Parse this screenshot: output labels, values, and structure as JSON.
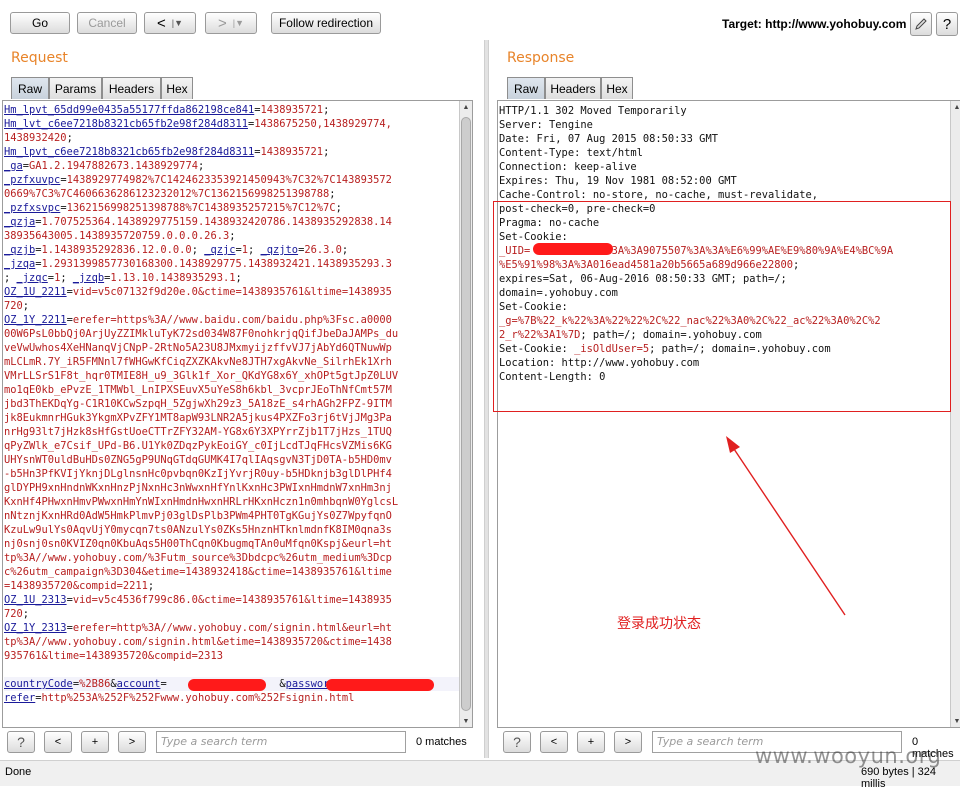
{
  "toolbar": {
    "go_label": "Go",
    "cancel_label": "Cancel",
    "back_symbol": "<",
    "back_dropdown": "|▼",
    "forward_symbol": ">",
    "forward_dropdown": "|▼",
    "follow_redirection_label": "Follow redirection",
    "target_label": "Target: http://www.yohobuy.com",
    "help_symbol": "?"
  },
  "request": {
    "title": "Request",
    "tabs": [
      "Raw",
      "Params",
      "Headers",
      "Hex"
    ],
    "active_tab": "Raw",
    "lines": [
      [
        [
          "k",
          "Hm_lpvt_65dd99e0435a55177ffda862198ce841"
        ],
        [
          "t",
          "="
        ],
        [
          "v",
          "1438935721"
        ],
        [
          "t",
          ";"
        ]
      ],
      [
        [
          "k",
          "Hm_lvt_c6ee7218b8321cb65fb2e98f284d8311"
        ],
        [
          "t",
          "="
        ],
        [
          "v",
          "1438675250,1438929774,"
        ]
      ],
      [
        [
          "v",
          "1438932420"
        ],
        [
          "t",
          ";"
        ]
      ],
      [
        [
          "k",
          "Hm_lpvt_c6ee7218b8321cb65fb2e98f284d8311"
        ],
        [
          "t",
          "="
        ],
        [
          "v",
          "1438935721"
        ],
        [
          "t",
          ";"
        ]
      ],
      [
        [
          "k",
          "_ga"
        ],
        [
          "t",
          "="
        ],
        [
          "v",
          "GA1.2.1947882673.1438929774"
        ],
        [
          "t",
          ";"
        ]
      ],
      [
        [
          "k",
          "_pzfxuvpc"
        ],
        [
          "t",
          "="
        ],
        [
          "v",
          "1438929774982%7C1424623353921450943%7C32%7C143893572"
        ]
      ],
      [
        [
          "v",
          "0669%7C3%7C4606636286123232012%7C1362156998251398788"
        ],
        [
          "t",
          ";"
        ]
      ],
      [
        [
          "k",
          "_pzfxsvpc"
        ],
        [
          "t",
          "="
        ],
        [
          "v",
          "1362156998251398788%7C1438935257215%7C12%7C"
        ],
        [
          "t",
          ";"
        ]
      ],
      [
        [
          "k",
          "_qzja"
        ],
        [
          "t",
          "="
        ],
        [
          "v",
          "1.707525364.1438929775159.1438932420786.1438935292838.14"
        ]
      ],
      [
        [
          "v",
          "38935643005.1438935720759.0.0.0.26.3"
        ],
        [
          "t",
          ";"
        ]
      ],
      [
        [
          "k",
          "_qzjb"
        ],
        [
          "t",
          "="
        ],
        [
          "v",
          "1.1438935292836.12.0.0.0"
        ],
        [
          "t",
          "; "
        ],
        [
          "k",
          "_qzjc"
        ],
        [
          "t",
          "="
        ],
        [
          "v",
          "1"
        ],
        [
          "t",
          "; "
        ],
        [
          "k",
          "_qzjto"
        ],
        [
          "t",
          "="
        ],
        [
          "v",
          "26.3.0"
        ],
        [
          "t",
          ";"
        ]
      ],
      [
        [
          "k",
          "_jzqa"
        ],
        [
          "t",
          "="
        ],
        [
          "v",
          "1.2931399857730168300.1438929775.1438932421.1438935293.3"
        ]
      ],
      [
        [
          "t",
          "; "
        ],
        [
          "k",
          "_jzqc"
        ],
        [
          "t",
          "="
        ],
        [
          "v",
          "1"
        ],
        [
          "t",
          "; "
        ],
        [
          "k",
          "_jzqb"
        ],
        [
          "t",
          "="
        ],
        [
          "v",
          "1.13.10.1438935293.1"
        ],
        [
          "t",
          ";"
        ]
      ],
      [
        [
          "k",
          "OZ_1U_2211"
        ],
        [
          "t",
          "="
        ],
        [
          "v",
          "vid=v5c07132f9d20e.0&ctime=1438935761&ltime=1438935"
        ]
      ],
      [
        [
          "v",
          "720"
        ],
        [
          "t",
          ";"
        ]
      ],
      [
        [
          "k",
          "OZ_1Y_2211"
        ],
        [
          "t",
          "="
        ],
        [
          "v",
          "erefer=https%3A//www.baidu.com/baidu.php%3Fsc.a0000"
        ]
      ],
      [
        [
          "v",
          "00W6PsL0bbQj0ArjUyZZIMkluTyK72sd034W87F0nohkrjqQifJbeDaJAMPs_du"
        ]
      ],
      [
        [
          "v",
          "veVwUwhos4XeHNanqVjCNpP-2RtNo5A23U8JMxmyijzffvVJ7jAbYd6QTNuwWp"
        ]
      ],
      [
        [
          "v",
          "mLCLmR.7Y_iR5FMNnl7fWHGwKfCiqZXZKAkvNe8JTH7xgAkvNe_SilrhEk1Xrh"
        ]
      ],
      [
        [
          "v",
          "VMrLLSrS1F8t_hqr0TMIE8H_u9_3Glk1f_Xor_QKdYG8x6Y_xhOPt5gtJpZ0LUV"
        ]
      ],
      [
        [
          "v",
          "mo1qE0kb_ePvzE_1TMWbl_LnIPXSEuvX5uYeS8h6kbl_3vcprJEoThNfCmt57M"
        ]
      ],
      [
        [
          "v",
          "jbd3ThEKDqYg-C1R10KCwSzpqH_5ZgjwXh29z3_5A18zE_s4rhAGh2FPZ-9ITM"
        ]
      ],
      [
        [
          "v",
          "jk8EukmnrHGuk3YkgmXPvZFY1MT8apW93LNR2A5jkus4PXZFo3rj6tVjJMg3Pa"
        ]
      ],
      [
        [
          "v",
          "nrHg93lt7jHzk8sHfGstUoeCTTrZFY32AM-YG8x6Y3XPYrrZjb1T7jHzs_1TUQ"
        ]
      ],
      [
        [
          "v",
          "qPyZWlk_e7Csif_UPd-B6.U1Yk0ZDqzPykEoiGY_c0IjLcdTJqFHcsVZMis6KG"
        ]
      ],
      [
        [
          "v",
          "UHYsnWT0uldBuHDs0ZNG5gP9UNqGTdqGUMK4I7qlIAqsgvN3TjD0TA-b5HD0mv"
        ]
      ],
      [
        [
          "v",
          "-b5Hn3PfKVIjYknjDLglnsnHc0pvbqn0KzIjYvrjR0uy-b5HDknjb3glDlPHf4"
        ]
      ],
      [
        [
          "v",
          "glDYPH9xnHndnWKxnHnzPjNxnHc3nWwxnHfYnlKxnHc3PWIxnHmdnW7xnHm3nj"
        ]
      ],
      [
        [
          "v",
          "KxnHf4PHwxnHmvPWwxnHmYnWIxnHmdnHwxnHRLrHKxnHczn1n0mhbqnW0YglcsL"
        ]
      ],
      [
        [
          "v",
          "nNtznjKxnHRd0AdW5HmkPlmvPj03glDsPlb3PWm4PHT0TgKGujYs0Z7WpyfqnO"
        ]
      ],
      [
        [
          "v",
          "KzuLw9ulYs0AqvUjY0mycqn7ts0ANzulYs0ZKs5HnznHTknlmdnfK8IM0qna3s"
        ]
      ],
      [
        [
          "v",
          "nj0snj0sn0KVIZ0qn0KbuAqs5H00ThCqn0KbugmqTAn0uMfqn0Kspj&eurl=ht"
        ]
      ],
      [
        [
          "v",
          "tp%3A//www.yohobuy.com/%3Futm_source%3Dbdcpc%26utm_medium%3Dcp"
        ]
      ],
      [
        [
          "v",
          "c%26utm_campaign%3D304&etime=1438932418&ctime=1438935761&ltime"
        ]
      ],
      [
        [
          "v",
          "=1438935720&compid=2211"
        ],
        [
          "t",
          ";"
        ]
      ],
      [
        [
          "k",
          "OZ_1U_2313"
        ],
        [
          "t",
          "="
        ],
        [
          "v",
          "vid=v5c4536f799c86.0&ctime=1438935761&ltime=1438935"
        ]
      ],
      [
        [
          "v",
          "720"
        ],
        [
          "t",
          ";"
        ]
      ],
      [
        [
          "k",
          "OZ_1Y_2313"
        ],
        [
          "t",
          "="
        ],
        [
          "v",
          "erefer=http%3A//www.yohobuy.com/signin.html&eurl=ht"
        ]
      ],
      [
        [
          "v",
          "tp%3A//www.yohobuy.com/signin.html&etime=1438935720&ctime=1438"
        ]
      ],
      [
        [
          "v",
          "935761&ltime=1438935720&compid=2313"
        ]
      ],
      [
        [
          "t",
          ""
        ]
      ],
      [
        [
          "k",
          "countryCode"
        ],
        [
          "t",
          "="
        ],
        [
          "v",
          "%2B86"
        ],
        [
          "t",
          "&"
        ],
        [
          "k",
          "account"
        ],
        [
          "t",
          "="
        ],
        [
          "v",
          "                  "
        ],
        [
          "t",
          "&"
        ],
        [
          "k",
          "password"
        ],
        [
          "t",
          "="
        ],
        [
          "v",
          "                   "
        ]
      ],
      [
        [
          "k",
          "refer"
        ],
        [
          "t",
          "="
        ],
        [
          "v",
          "http%253A%252F%252Fwww.yohobuy.com%252Fsignin.html"
        ]
      ]
    ]
  },
  "response": {
    "title": "Response",
    "tabs": [
      "Raw",
      "Headers",
      "Hex"
    ],
    "active_tab": "Raw",
    "lines": [
      [
        [
          "t",
          "HTTP/1.1 302 Moved Temporarily"
        ]
      ],
      [
        [
          "t",
          "Server: Tengine"
        ]
      ],
      [
        [
          "t",
          "Date: Fri, 07 Aug 2015 08:50:33 GMT"
        ]
      ],
      [
        [
          "t",
          "Content-Type: text/html"
        ]
      ],
      [
        [
          "t",
          "Connection: keep-alive"
        ]
      ],
      [
        [
          "t",
          "Expires: Thu, 19 Nov 1981 08:52:00 GMT"
        ]
      ],
      [
        [
          "t",
          "Cache-Control: no-store, no-cache, must-revalidate,"
        ]
      ],
      [
        [
          "t",
          "post-check=0, pre-check=0"
        ]
      ],
      [
        [
          "t",
          "Pragma: no-cache"
        ]
      ],
      [
        [
          "t",
          "Set-Cookie:"
        ]
      ],
      [
        [
          "v",
          "_UID="
        ],
        [
          "v",
          "            "
        ],
        [
          "v",
          "%3A%3A9075507%3A%3A%E6%99%AE%E9%80%9A%E4%BC%9A"
        ]
      ],
      [
        [
          "v",
          "%E5%91%98%3A%3A016ead4581a20b5665a689d966e22800"
        ],
        [
          "t",
          ";"
        ]
      ],
      [
        [
          "t",
          "expires=Sat, 06-Aug-2016 08:50:33 GMT; path=/;"
        ]
      ],
      [
        [
          "t",
          "domain=.yohobuy.com"
        ]
      ],
      [
        [
          "t",
          "Set-Cookie:"
        ]
      ],
      [
        [
          "v",
          "_g=%7B%22_k%22%3A%22%22%2C%22_nac%22%3A0%2C%22_ac%22%3A0%2C%2"
        ]
      ],
      [
        [
          "v",
          "2_r%22%3A1%7D"
        ],
        [
          "t",
          "; path=/; domain=.yohobuy.com"
        ]
      ],
      [
        [
          "t",
          "Set-Cookie: "
        ],
        [
          "v",
          "_isOldUser=5"
        ],
        [
          "t",
          "; path=/; domain=.yohobuy.com"
        ]
      ],
      [
        [
          "t",
          "Location: http://www.yohobuy.com"
        ]
      ],
      [
        [
          "t",
          "Content-Length: 0"
        ]
      ]
    ]
  },
  "annotation": {
    "caption": "登录成功状态",
    "color": "#e02020"
  },
  "footer": {
    "help_symbol": "?",
    "prev_symbol": "<",
    "add_symbol": "+",
    "next_symbol": ">",
    "search_placeholder": "Type a search term",
    "request_matches": "0 matches",
    "response_matches": "0 matches"
  },
  "status": {
    "left": "Done",
    "right": "690 bytes | 324 millis"
  },
  "watermark": "www.wooyun.org",
  "colors": {
    "accent_orange": "#e8842a",
    "param_name_blue": "#1a1a9a",
    "param_value_red": "#b82020",
    "redaction_red": "#ff1a1a"
  }
}
